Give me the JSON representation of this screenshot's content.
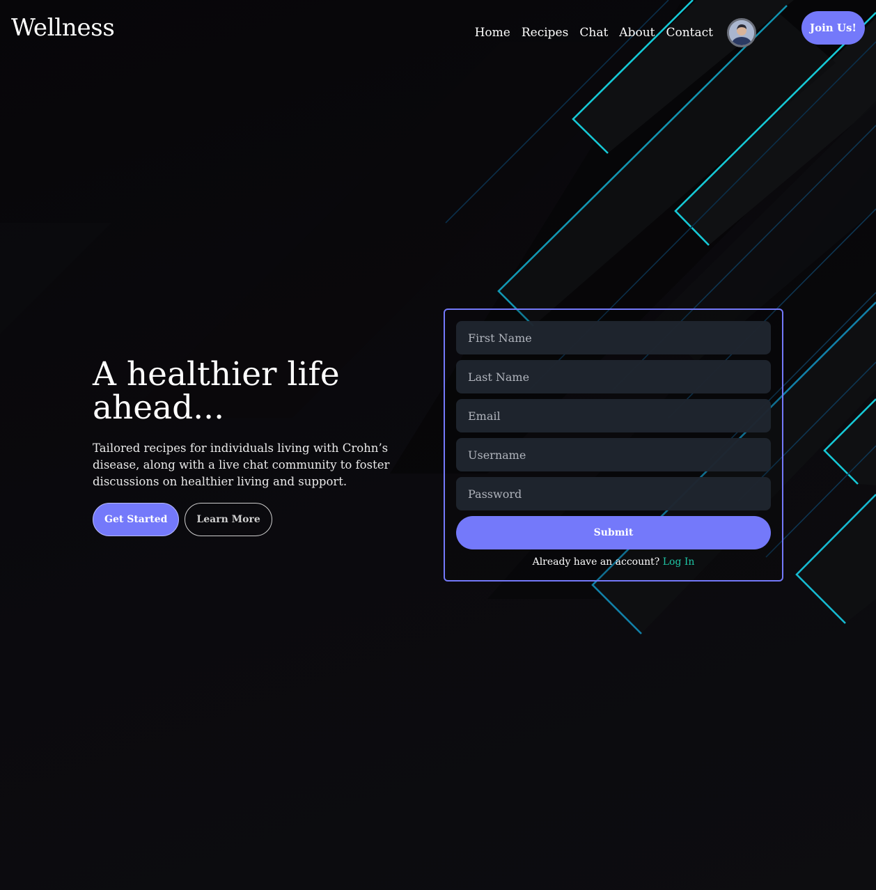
{
  "nav": {
    "brand": "Wellness",
    "links": [
      "Home",
      "Recipes",
      "Chat",
      "About",
      "Contact"
    ],
    "join_label": "Join Us!"
  },
  "hero": {
    "title": "A healthier life ahead...",
    "subtitle": "Tailored recipes for individuals living with Crohn’s disease, along with a live chat community to foster discussions on healthier living and support.",
    "primary_label": "Get Started",
    "secondary_label": "Learn More"
  },
  "form": {
    "first_name_placeholder": "First Name",
    "last_name_placeholder": "Last Name",
    "email_placeholder": "Email",
    "username_placeholder": "Username",
    "password_placeholder": "Password",
    "submit_label": "Submit",
    "login_prompt": "Already have an account?",
    "login_link": "Log In"
  },
  "colors": {
    "accent": "#7479fa",
    "link": "#1fc6a5",
    "decor_line": "#14c7d6"
  }
}
